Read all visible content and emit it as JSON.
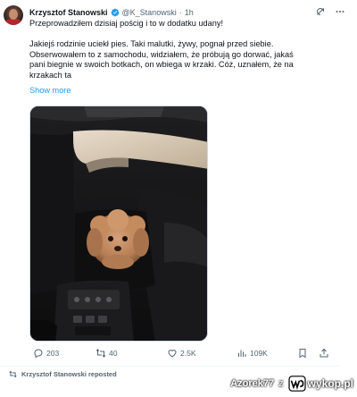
{
  "author": {
    "name": "Krzysztof Stanowski",
    "handle": "@K_Stanowski",
    "separator": "·",
    "time": "1h"
  },
  "tweet": {
    "line1": "Przeprowadziłem dzisiaj pościg i to w dodatku udany!",
    "line2": "Jakiejś rodzinie uciekł pies. Taki malutki, żywy, pognał przed siebie.",
    "line3": "Obserwowałem to z samochodu, widziałem, że próbują go dorwać, jakaś",
    "line4": "pani biegnie w swoich botkach, on wbiega w krzaki. Cóż, uznałem, że na",
    "line5": "krzakach ta",
    "show_more": "Show more"
  },
  "actions": {
    "replies": "203",
    "reposts": "40",
    "likes": "2.5K",
    "views": "109K"
  },
  "repost_notice": "Krzysztof Stanowski reposted",
  "watermark": {
    "author": "Azorek77",
    "connector": "z",
    "brand": "wykop.pl"
  },
  "colors": {
    "link": "#1d9bf0",
    "secondary_text": "#536471",
    "verified": "#1d9bf0",
    "divider": "#eff3f4"
  },
  "icons": [
    "verified-badge-icon",
    "grok-icon",
    "more-icon",
    "reply-icon",
    "retweet-icon",
    "like-icon",
    "views-icon",
    "bookmark-icon",
    "share-icon",
    "retweet-small-icon",
    "wykop-logo-icon"
  ]
}
